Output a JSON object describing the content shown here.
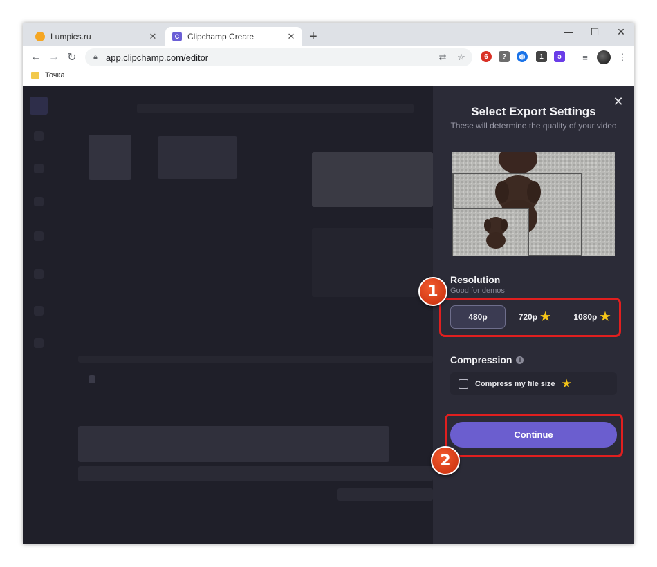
{
  "browser": {
    "tabs": [
      {
        "label": "Lumpics.ru",
        "close": "✕",
        "active": false
      },
      {
        "label": "Clipchamp Create",
        "close": "✕",
        "active": true
      }
    ],
    "new_tab": "+",
    "url": "app.clipchamp.com/editor",
    "bookmarks": [
      {
        "label": "Точка"
      }
    ],
    "extension_badges": {
      "ext1": "6",
      "ext4": "1"
    }
  },
  "panel": {
    "title": "Select Export Settings",
    "subtitle": "These will determine the quality of your video",
    "close": "✕",
    "resolution": {
      "label": "Resolution",
      "hint": "Good for demos",
      "options": [
        {
          "label": "480p",
          "selected": true,
          "premium": false
        },
        {
          "label": "720p",
          "selected": false,
          "premium": true
        },
        {
          "label": "1080p",
          "selected": false,
          "premium": true
        }
      ]
    },
    "compression": {
      "label": "Compression",
      "info": "i",
      "checkbox_label": "Compress my file size",
      "checked": false,
      "premium": true
    },
    "continue_label": "Continue"
  },
  "annotations": [
    {
      "number": "1"
    },
    {
      "number": "2"
    }
  ],
  "colors": {
    "accent": "#6b5ecf",
    "highlight": "#e01f1f",
    "star": "#f5c518",
    "panel_bg": "#2b2b37"
  }
}
